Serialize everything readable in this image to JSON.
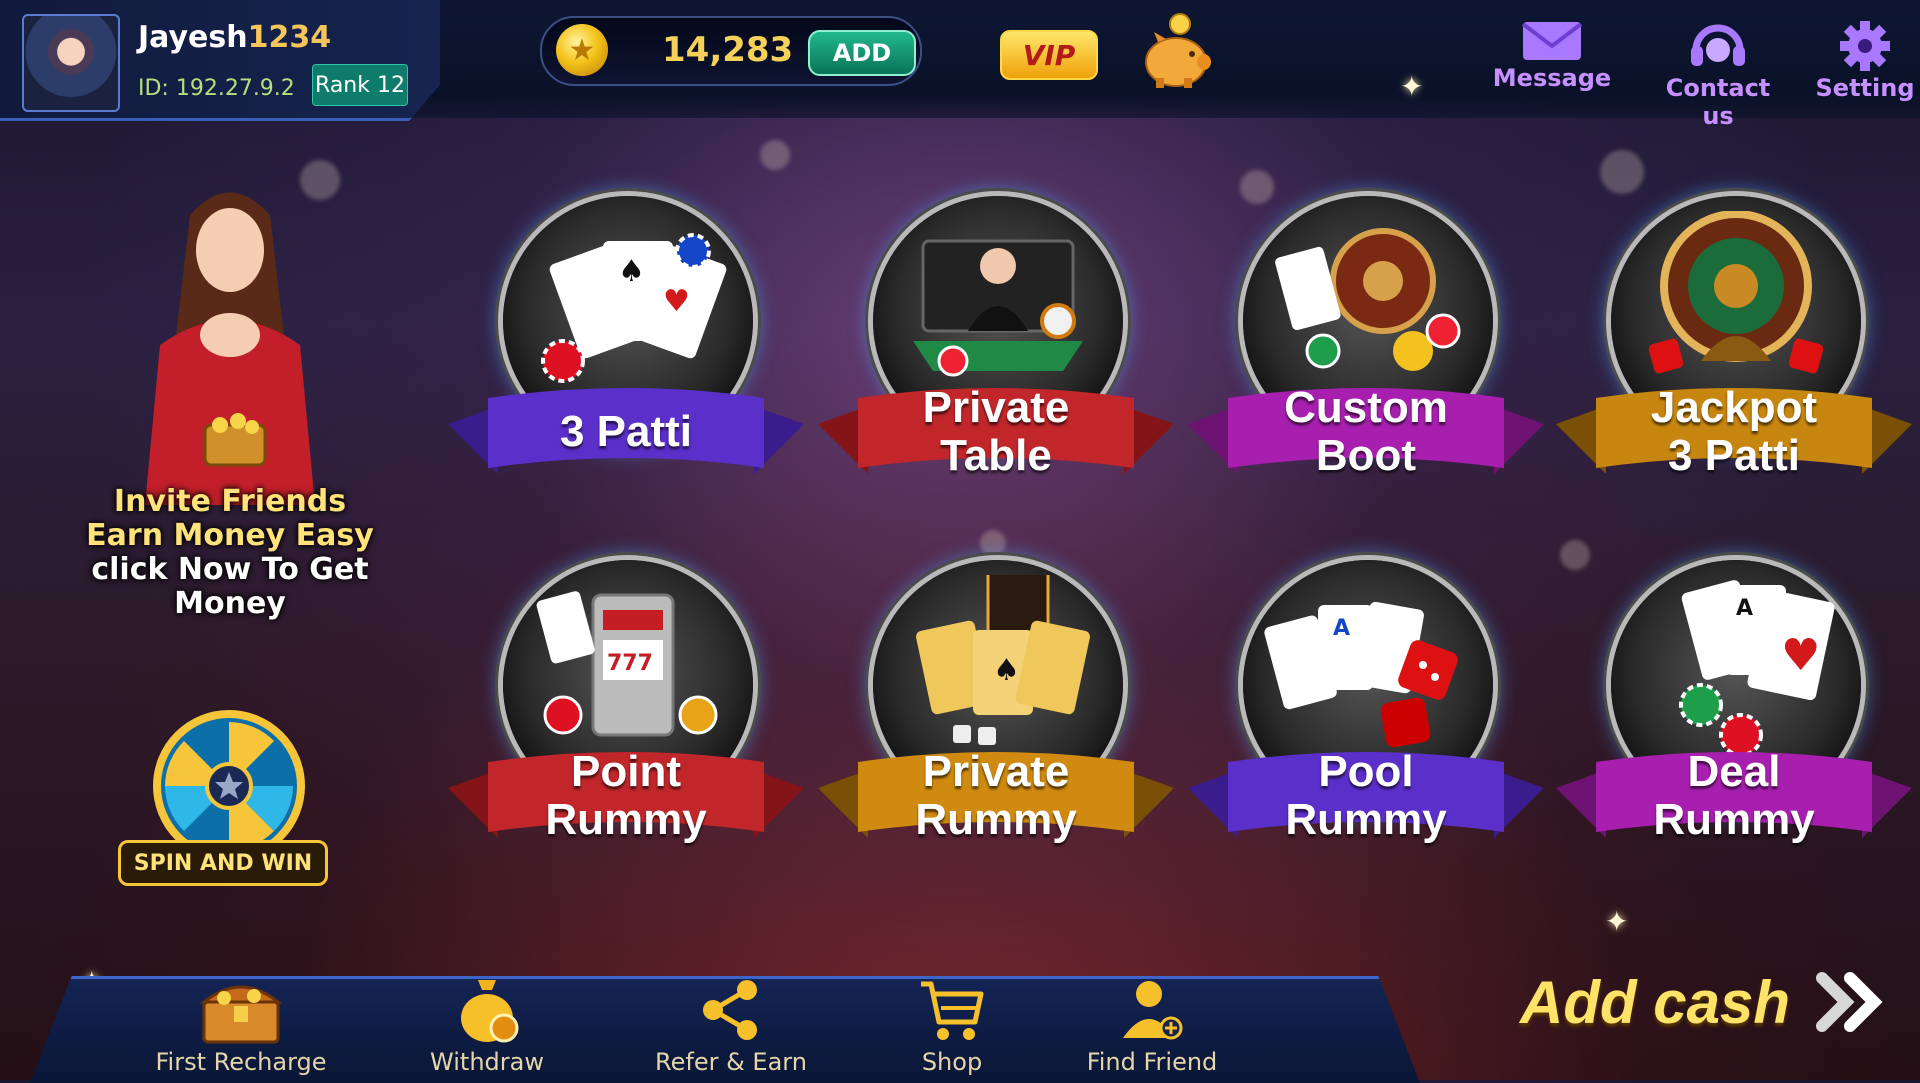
{
  "profile": {
    "username_name": "Jayesh",
    "username_digits": "1234",
    "id_text": "ID: 192.27.9.2",
    "rank_text": "Rank 12"
  },
  "wallet": {
    "coins": "14,283",
    "add_label": "ADD"
  },
  "vip_label": "VIP",
  "top_nav": [
    {
      "label": "Message",
      "icon": "envelope-icon"
    },
    {
      "label": "Contact us",
      "icon": "headset-icon"
    },
    {
      "label": "Setting",
      "icon": "gear-icon"
    }
  ],
  "promos": {
    "invite_lines": [
      "Invite Friends",
      "Earn Money Easy",
      "click Now To Get",
      "Money"
    ],
    "spin_label": "SPIN AND WIN"
  },
  "games": [
    {
      "line1": "3 Patti",
      "line2": "",
      "ribbon_color": "#5b2fc9",
      "art": "cards-chips"
    },
    {
      "line1": "Private",
      "line2": "Table",
      "ribbon_color": "#c0262a",
      "art": "live-dealer"
    },
    {
      "line1": "Custom",
      "line2": "Boot",
      "ribbon_color": "#a81fb0",
      "art": "roulette-cards"
    },
    {
      "line1": "Jackpot",
      "line2": "3 Patti",
      "ribbon_color": "#c7860f",
      "art": "roulette-jackpot"
    },
    {
      "line1": "Point",
      "line2": "Rummy",
      "ribbon_color": "#c0262a",
      "art": "slot-machine"
    },
    {
      "line1": "Private",
      "line2": "Rummy",
      "ribbon_color": "#d08a10",
      "art": "gold-cards"
    },
    {
      "line1": "Pool",
      "line2": "Rummy",
      "ribbon_color": "#5b2fc9",
      "art": "cards-dice"
    },
    {
      "line1": "Deal",
      "line2": "Rummy",
      "ribbon_color": "#a81fb0",
      "art": "aces-chips"
    }
  ],
  "bottom_nav": [
    {
      "label": "First Recharge",
      "icon": "treasure-chest-icon"
    },
    {
      "label": "Withdraw",
      "icon": "money-bag-icon"
    },
    {
      "label": "Refer & Earn",
      "icon": "share-icon"
    },
    {
      "label": "Shop",
      "icon": "cart-icon"
    },
    {
      "label": "Find Friend",
      "icon": "add-friend-icon"
    }
  ],
  "add_cash_label": "Add cash"
}
